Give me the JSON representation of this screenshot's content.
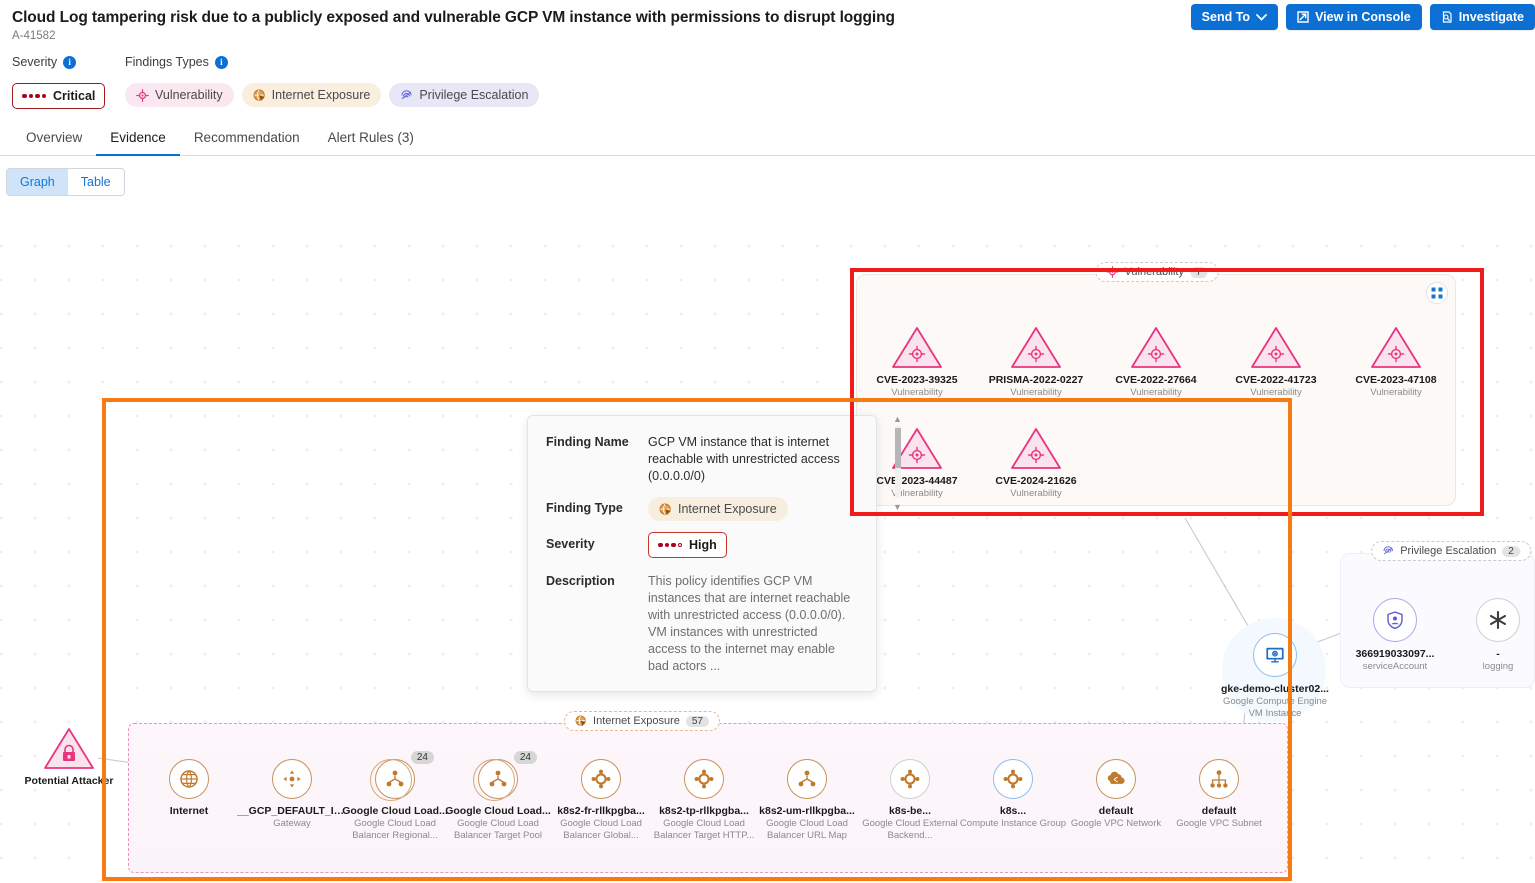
{
  "header": {
    "title": "Cloud Log tampering risk due to a publicly exposed and vulnerable GCP VM instance with permissions to disrupt logging",
    "alert_id": "A-41582",
    "actions": [
      {
        "label": "Send To",
        "icon": "chevron-down-icon"
      },
      {
        "label": "View in Console",
        "icon": "external-link-icon"
      },
      {
        "label": "Investigate",
        "icon": "investigate-icon"
      }
    ]
  },
  "meta": {
    "severity_label": "Severity",
    "severity_value": "Critical",
    "findings_types_label": "Findings Types",
    "finding_chips": [
      {
        "label": "Vulnerability",
        "icon": "crosshair-icon",
        "color": "#fbe7ef"
      },
      {
        "label": "Internet Exposure",
        "icon": "globe-cursor-icon",
        "color": "#faeede"
      },
      {
        "label": "Privilege Escalation",
        "icon": "fingerprint-icon",
        "color": "#e7e7f7"
      }
    ]
  },
  "tabs": [
    {
      "label": "Overview",
      "active": false
    },
    {
      "label": "Evidence",
      "active": true
    },
    {
      "label": "Recommendation",
      "active": false
    },
    {
      "label": "Alert Rules (3)",
      "active": false
    }
  ],
  "view_toggle": [
    {
      "label": "Graph",
      "active": true
    },
    {
      "label": "Table",
      "active": false
    }
  ],
  "clusters": {
    "vulnerability": {
      "pill_label": "Vulnerability",
      "count": "7",
      "collapse_icon": "collapse-icon",
      "nodes": [
        {
          "label": "CVE-2023-39325",
          "sub": "Vulnerability"
        },
        {
          "label": "PRISMA-2022-0227",
          "sub": "Vulnerability"
        },
        {
          "label": "CVE-2022-27664",
          "sub": "Vulnerability"
        },
        {
          "label": "CVE-2022-41723",
          "sub": "Vulnerability"
        },
        {
          "label": "CVE-2023-47108",
          "sub": "Vulnerability"
        },
        {
          "label": "CVE-2023-44487",
          "sub": "Vulnerability"
        },
        {
          "label": "CVE-2024-21626",
          "sub": "Vulnerability"
        }
      ]
    },
    "internet_exposure": {
      "pill_label": "Internet Exposure",
      "count": "57",
      "nodes": [
        {
          "label": "Internet",
          "sub": "",
          "badge": ""
        },
        {
          "label": "__GCP_DEFAULT_INTER...",
          "sub": "Gateway",
          "badge": ""
        },
        {
          "label": "Google Cloud Load...",
          "sub": "Google Cloud Load Balancer Regional...",
          "badge": "24"
        },
        {
          "label": "Google Cloud Load...",
          "sub": "Google Cloud Load Balancer Target Pool",
          "badge": "24"
        },
        {
          "label": "k8s2-fr-rllkpgba...",
          "sub": "Google Cloud Load Balancer Global...",
          "badge": ""
        },
        {
          "label": "k8s2-tp-rllkpgba...",
          "sub": "Google Cloud Load Balancer Target HTTP...",
          "badge": ""
        },
        {
          "label": "k8s2-um-rllkpgba...",
          "sub": "Google Cloud Load Balancer URL Map",
          "badge": ""
        },
        {
          "label": "k8s-be...",
          "sub": "Google Cloud External Backend...",
          "badge": ""
        },
        {
          "label": "k8s...",
          "sub": "Compute Instance Group",
          "badge": ""
        },
        {
          "label": "default",
          "sub": "Google VPC Network",
          "badge": ""
        },
        {
          "label": "default",
          "sub": "Google VPC Subnet",
          "badge": ""
        }
      ]
    },
    "privilege_escalation": {
      "pill_label": "Privilege Escalation",
      "count": "2",
      "nodes": [
        {
          "label": "366919033097...",
          "sub": "serviceAccount"
        },
        {
          "label": "-",
          "sub": "logging"
        }
      ]
    }
  },
  "attacker_node": {
    "label": "Potential Attacker",
    "sub": ""
  },
  "vm_node": {
    "label": "gke-demo-cluster02...",
    "sub": "Google Compute Engine VM Instance"
  },
  "popover": {
    "rows": [
      {
        "key": "Finding Name",
        "value": "GCP VM instance that is internet reachable with unrestricted access (0.0.0.0/0)"
      },
      {
        "key": "Finding Type",
        "value": "Internet Exposure"
      },
      {
        "key": "Severity",
        "value": "High"
      },
      {
        "key": "Description",
        "value": "This policy identifies GCP VM instances that are internet reachable with unrestricted access (0.0.0.0/0). VM instances with unrestricted access to the internet may enable bad actors ..."
      }
    ]
  },
  "colors": {
    "primary_blue": "#0b6fd4",
    "critical_red": "#9e1b1b",
    "high_red": "#b00020",
    "highlight_red": "#f01b1b",
    "highlight_orange": "#f57c12",
    "vuln_pink": "#e8357f",
    "inet_orange": "#c8925c",
    "priv_purple": "#6a6ad8"
  }
}
